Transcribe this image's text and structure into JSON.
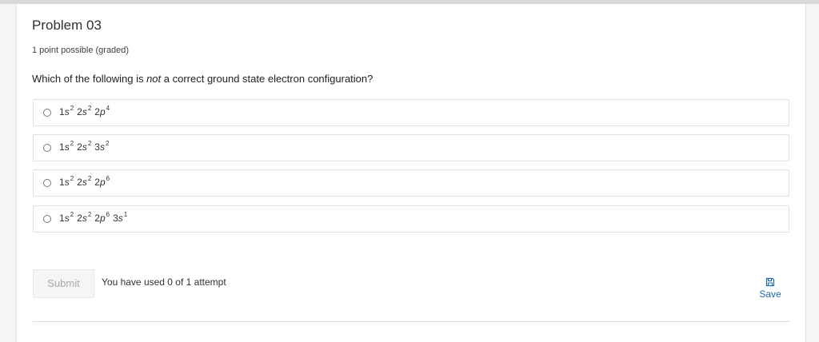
{
  "problem": {
    "title": "Problem 03",
    "points": "1 point possible (graded)",
    "question_pre": "Which of the following is ",
    "question_em": "not",
    "question_post": " a correct ground state electron configuration?"
  },
  "choices": [
    {
      "terms": [
        {
          "n": "1",
          "l": "s",
          "e": "2"
        },
        {
          "n": "2",
          "l": "s",
          "e": "2"
        },
        {
          "n": "2",
          "l": "p",
          "e": "4"
        }
      ]
    },
    {
      "terms": [
        {
          "n": "1",
          "l": "s",
          "e": "2"
        },
        {
          "n": "2",
          "l": "s",
          "e": "2"
        },
        {
          "n": "3",
          "l": "s",
          "e": "2"
        }
      ]
    },
    {
      "terms": [
        {
          "n": "1",
          "l": "s",
          "e": "2"
        },
        {
          "n": "2",
          "l": "s",
          "e": "2"
        },
        {
          "n": "2",
          "l": "p",
          "e": "6"
        }
      ]
    },
    {
      "terms": [
        {
          "n": "1",
          "l": "s",
          "e": "2"
        },
        {
          "n": "2",
          "l": "s",
          "e": "2"
        },
        {
          "n": "2",
          "l": "p",
          "e": "6"
        },
        {
          "n": "3",
          "l": "s",
          "e": "1"
        }
      ]
    }
  ],
  "actions": {
    "submit_label": "Submit",
    "attempts_text": "You have used 0 of 1 attempt",
    "save_label": "Save",
    "save_icon": "floppy-disk-icon"
  },
  "colors": {
    "link": "#1a6aad",
    "disabled_text": "#a8a8a8"
  }
}
